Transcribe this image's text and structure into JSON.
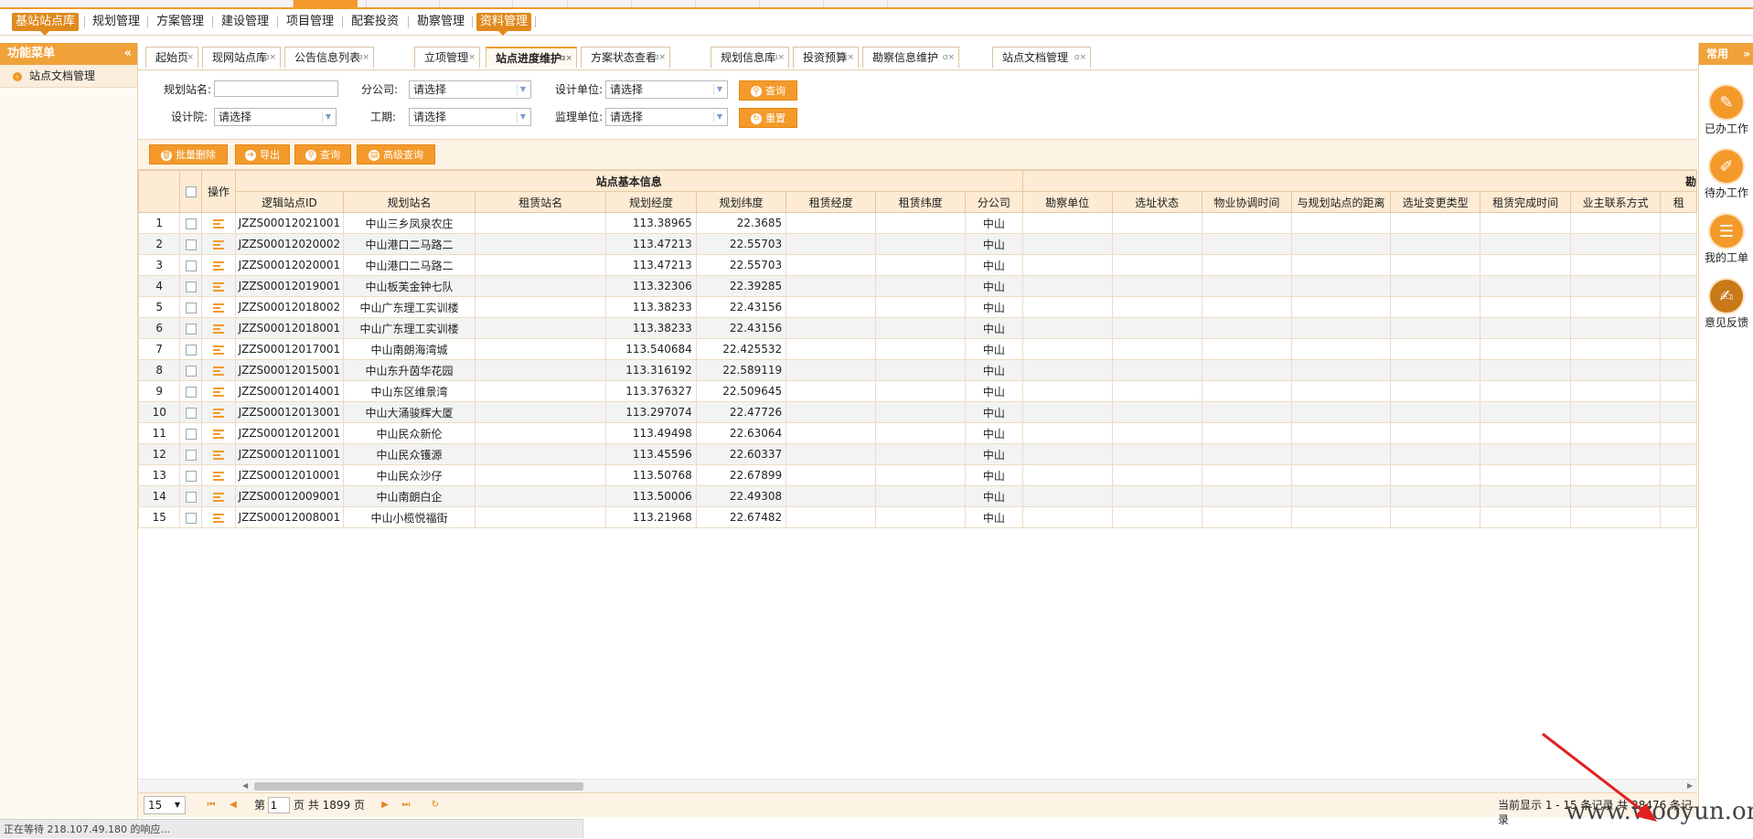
{
  "top_nav": {
    "items": [
      "基站站点库",
      "规划管理",
      "方案管理",
      "建设管理",
      "项目管理",
      "配套投资",
      "勘察管理",
      "资料管理"
    ]
  },
  "sidebar": {
    "title": "功能菜单",
    "collapse_icon": "double-chevron-left-icon",
    "items": [
      "站点文档管理"
    ]
  },
  "right_panel": {
    "title": "常用",
    "items": [
      {
        "label": "已办工作",
        "icon": "pencil-icon"
      },
      {
        "label": "待办工作",
        "icon": "edit-icon"
      },
      {
        "label": "我的工单",
        "icon": "list-icon"
      },
      {
        "label": "意见反馈",
        "icon": "feedback-icon"
      }
    ]
  },
  "page_tabs": [
    "起始页",
    "现网站点库",
    "公告信息列表",
    "立项管理",
    "站点进度维护",
    "方案状态查看",
    "规划信息库",
    "投资预算",
    "勘察信息维护",
    "站点文档管理"
  ],
  "active_tab": "站点进度维护",
  "search": {
    "plan_site_label": "规划站名:",
    "plan_site_value": "",
    "branch_label": "分公司:",
    "branch_value": "请选择",
    "design_unit_label": "设计单位:",
    "design_unit_value": "请选择",
    "design_inst_label": "设计院:",
    "design_inst_value": "请选择",
    "period_label": "工期:",
    "period_value": "请选择",
    "supervision_label": "监理单位:",
    "supervision_value": "请选择",
    "query_button": "查询",
    "reset_button": "重置"
  },
  "toolbar": {
    "batch_delete": "批量删除",
    "export": "导出",
    "query": "查询",
    "advanced_query": "高级查询"
  },
  "table": {
    "group_header": "站点基本信息",
    "group_header_right": "勘",
    "op_header": "操作",
    "columns": [
      "逻辑站点ID",
      "规划站名",
      "租赁站名",
      "规划经度",
      "规划纬度",
      "租赁经度",
      "租赁纬度",
      "分公司",
      "勘察单位",
      "选址状态",
      "物业协调时间",
      "与规划站点的距离",
      "选址变更类型",
      "租赁完成时间",
      "业主联系方式",
      "租"
    ],
    "rows": [
      {
        "n": "1",
        "id": "JZZS00012021001",
        "name": "中山三乡凤泉农庄",
        "lng": "113.38965",
        "lat": "22.3685",
        "branch": "中山"
      },
      {
        "n": "2",
        "id": "JZZS00012020002",
        "name": "中山港口二马路二",
        "lng": "113.47213",
        "lat": "22.55703",
        "branch": "中山"
      },
      {
        "n": "3",
        "id": "JZZS00012020001",
        "name": "中山港口二马路二",
        "lng": "113.47213",
        "lat": "22.55703",
        "branch": "中山"
      },
      {
        "n": "4",
        "id": "JZZS00012019001",
        "name": "中山板芙金钟七队",
        "lng": "113.32306",
        "lat": "22.39285",
        "branch": "中山"
      },
      {
        "n": "5",
        "id": "JZZS00012018002",
        "name": "中山广东理工实训楼",
        "lng": "113.38233",
        "lat": "22.43156",
        "branch": "中山"
      },
      {
        "n": "6",
        "id": "JZZS00012018001",
        "name": "中山广东理工实训楼",
        "lng": "113.38233",
        "lat": "22.43156",
        "branch": "中山"
      },
      {
        "n": "7",
        "id": "JZZS00012017001",
        "name": "中山南朗海湾城",
        "lng": "113.540684",
        "lat": "22.425532",
        "branch": "中山"
      },
      {
        "n": "8",
        "id": "JZZS00012015001",
        "name": "中山东升茵华花园",
        "lng": "113.316192",
        "lat": "22.589119",
        "branch": "中山"
      },
      {
        "n": "9",
        "id": "JZZS00012014001",
        "name": "中山东区维景湾",
        "lng": "113.376327",
        "lat": "22.509645",
        "branch": "中山"
      },
      {
        "n": "10",
        "id": "JZZS00012013001",
        "name": "中山大涌骏辉大厦",
        "lng": "113.297074",
        "lat": "22.47726",
        "branch": "中山"
      },
      {
        "n": "11",
        "id": "JZZS00012012001",
        "name": "中山民众新伦",
        "lng": "113.49498",
        "lat": "22.63064",
        "branch": "中山"
      },
      {
        "n": "12",
        "id": "JZZS00012011001",
        "name": "中山民众镬源",
        "lng": "113.45596",
        "lat": "22.60337",
        "branch": "中山"
      },
      {
        "n": "13",
        "id": "JZZS00012010001",
        "name": "中山民众沙仔",
        "lng": "113.50768",
        "lat": "22.67899",
        "branch": "中山"
      },
      {
        "n": "14",
        "id": "JZZS00012009001",
        "name": "中山南朗白企",
        "lng": "113.50006",
        "lat": "22.49308",
        "branch": "中山"
      },
      {
        "n": "15",
        "id": "JZZS00012008001",
        "name": "中山小榄悦福街",
        "lng": "113.21968",
        "lat": "22.67482",
        "branch": "中山"
      }
    ]
  },
  "pager": {
    "page_size": "15",
    "page_prefix": "第",
    "page_value": "1",
    "page_suffix": "页 共 1899 页",
    "summary": "当前显示 1 - 15 条记录 共 28476 条记录"
  },
  "status_text": "正在等待 218.107.49.180 的响应...",
  "watermark": "www.wooyun.org",
  "colors": {
    "accent": "#f39a2b",
    "header_bg": "#fdebd3",
    "annotation": "#e02020"
  }
}
